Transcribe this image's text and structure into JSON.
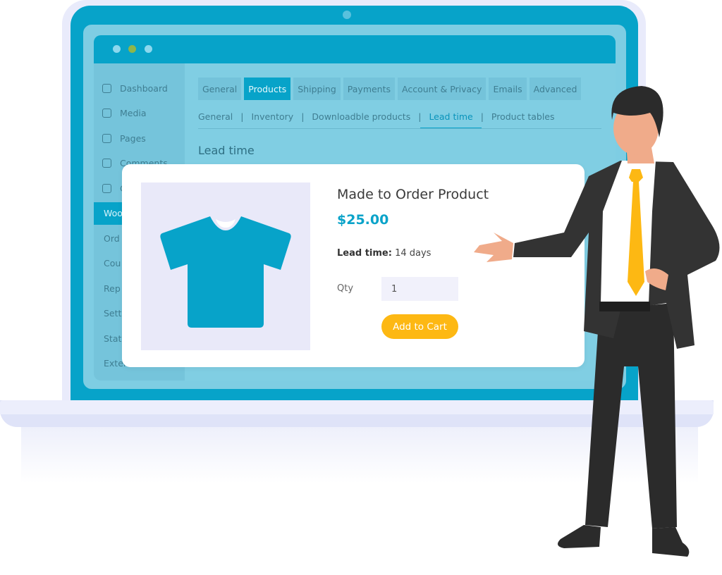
{
  "sidebar": {
    "items": [
      {
        "label": "Dashboard",
        "icon": "dashboard-icon"
      },
      {
        "label": "Media",
        "icon": "media-icon"
      },
      {
        "label": "Pages",
        "icon": "pages-icon"
      },
      {
        "label": "Comments",
        "icon": "comments-icon"
      },
      {
        "label": "C",
        "icon": "mail-icon"
      },
      {
        "label": "Woo",
        "active": true
      },
      {
        "label": "Ord"
      },
      {
        "label": "Cou"
      },
      {
        "label": "Rep"
      },
      {
        "label": "Sett"
      },
      {
        "label": "Stat"
      },
      {
        "label": "Extensions"
      }
    ]
  },
  "tabs": [
    "General",
    "Products",
    "Shipping",
    "Payments",
    "Account & Privacy",
    "Emails",
    "Advanced"
  ],
  "active_tab": "Products",
  "subtabs": [
    "General",
    "Inventory",
    "Downloadble products",
    "Lead time",
    "Product tables"
  ],
  "active_subtab": "Lead time",
  "section_heading": "Lead time",
  "product": {
    "title": "Made to Order Product",
    "price": "$25.00",
    "lead_label": "Lead time:",
    "lead_value": "14 days",
    "qty_label": "Qty",
    "qty_value": "1",
    "add_to_cart": "Add to Cart",
    "image_icon": "tshirt-icon"
  },
  "colors": {
    "accent": "#07a3c9",
    "button": "#fdb813",
    "tie": "#fdb813",
    "suit": "#333333"
  }
}
